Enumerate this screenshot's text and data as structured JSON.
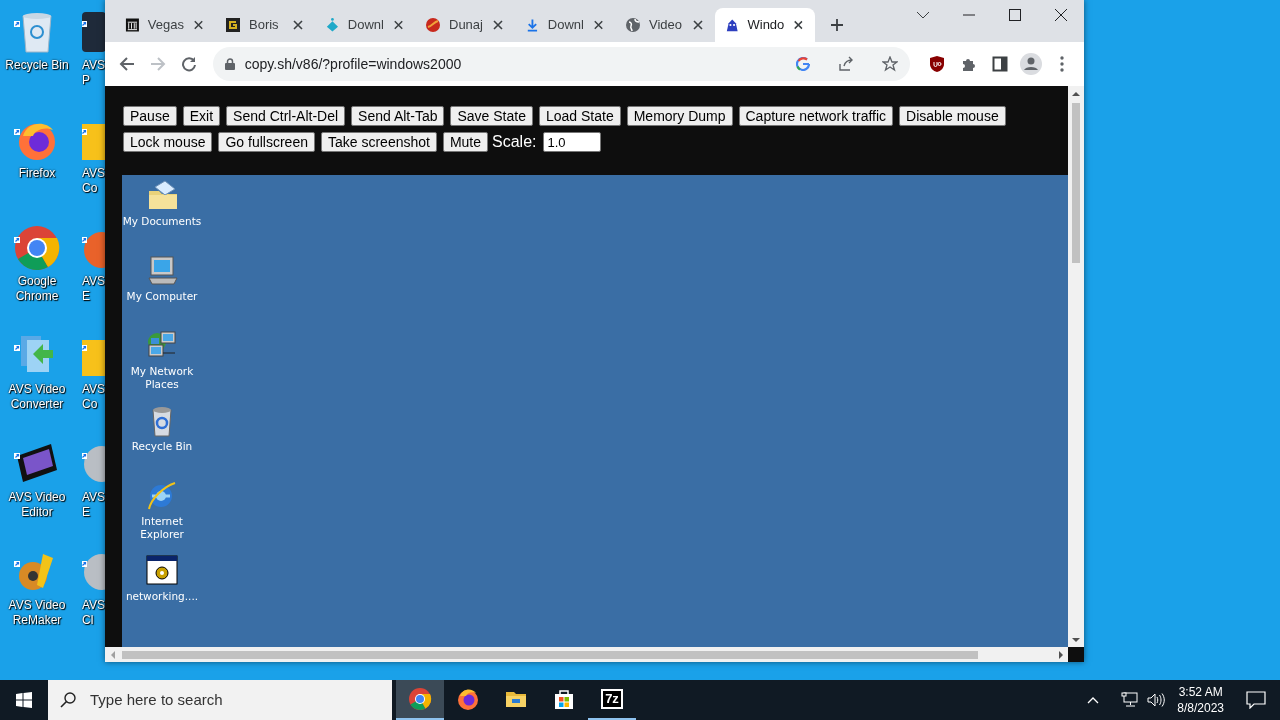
{
  "desktop_icons": [
    {
      "label": "Recycle Bin",
      "kind": "recycle"
    },
    {
      "label": "Firefox",
      "kind": "firefox"
    },
    {
      "label": "Google Chrome",
      "kind": "chrome"
    },
    {
      "label": "AVS Video Converter",
      "kind": "converter"
    },
    {
      "label": "AVS Video Editor",
      "kind": "editor"
    },
    {
      "label": "AVS Video ReMaker",
      "kind": "remaker"
    }
  ],
  "partly_hidden_icons": [
    {
      "label": "AVS P",
      "kind": "avs-dark"
    },
    {
      "label": "AVS Co",
      "kind": "avs-yellow"
    },
    {
      "label": "AVS E",
      "kind": "avs-orange"
    },
    {
      "label": "AVS Co",
      "kind": "avs-yellow"
    },
    {
      "label": "AVS E",
      "kind": "avs-grey"
    },
    {
      "label": "AVS Cl",
      "kind": "avs-grey"
    }
  ],
  "browser": {
    "tabs": [
      {
        "title": "Vegas",
        "kind": "columns",
        "selected": false
      },
      {
        "title": "Boris",
        "kind": "square",
        "selected": false
      },
      {
        "title": "Downl",
        "kind": "diamond",
        "selected": false
      },
      {
        "title": "Dunaj",
        "kind": "ball",
        "selected": false
      },
      {
        "title": "Downl",
        "kind": "download",
        "selected": false
      },
      {
        "title": "Video",
        "kind": "globe",
        "selected": false
      },
      {
        "title": "Windo",
        "kind": "creature",
        "selected": true
      }
    ],
    "address": "copy.sh/v86/?profile=windows2000",
    "forward_disabled": true,
    "emulator": {
      "button_rows": [
        [
          "Pause",
          "Exit",
          "Send Ctrl-Alt-Del",
          "Send Alt-Tab",
          "Save State",
          "Load State",
          "Memory Dump",
          "Capture network traffic",
          "Disable mouse"
        ],
        [
          "Lock mouse",
          "Go fullscreen",
          "Take screenshot",
          "Mute"
        ]
      ],
      "scale_label": "Scale:",
      "scale_value": "1.0",
      "guest_icons": [
        {
          "label": "My Documents",
          "kind": "documents"
        },
        {
          "label": "My Computer",
          "kind": "computer"
        },
        {
          "label": "My Network Places",
          "kind": "network"
        },
        {
          "label": "Recycle Bin",
          "kind": "recycle"
        },
        {
          "label": "Internet Explorer",
          "kind": "ie"
        },
        {
          "label": "networking....",
          "kind": "setup"
        }
      ]
    }
  },
  "taskbar": {
    "search_placeholder": "Type here to search",
    "apps": [
      {
        "kind": "chrome",
        "selected": true,
        "running": true
      },
      {
        "kind": "firefox",
        "selected": false,
        "running": false
      },
      {
        "kind": "explorer",
        "selected": false,
        "running": false
      },
      {
        "kind": "store",
        "selected": false,
        "running": false
      },
      {
        "kind": "sevenzip",
        "label": "7z",
        "selected": false,
        "running": true
      }
    ],
    "time": "3:52 AM",
    "date": "8/8/2023"
  }
}
